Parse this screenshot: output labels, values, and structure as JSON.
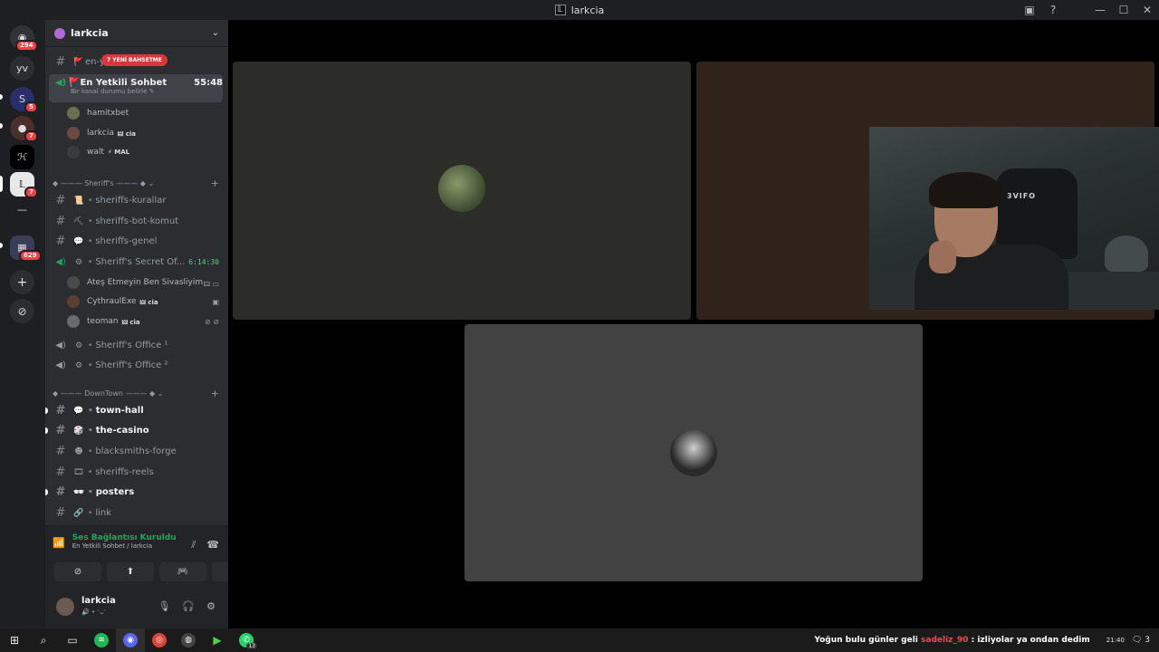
{
  "window": {
    "title": "larkcia"
  },
  "guilds": [
    {
      "name": "discord-home",
      "glyph": "◉",
      "badge": "294"
    },
    {
      "name": "yv",
      "glyph": "yv",
      "badge": ""
    },
    {
      "name": "server-s",
      "glyph": "S",
      "badge": "5"
    },
    {
      "name": "server-photo",
      "glyph": "●",
      "badge": "7"
    },
    {
      "name": "server-h",
      "glyph": "ℋ",
      "badge": ""
    },
    {
      "name": "server-l",
      "glyph": "𝕃",
      "badge": "7"
    },
    {
      "name": "server-line",
      "glyph": "—",
      "badge": ""
    },
    {
      "name": "server-folder",
      "glyph": "▦",
      "badge": "629"
    }
  ],
  "server": {
    "name": "larkcia"
  },
  "mention_bar": "7 YENİ BAHSETME",
  "channels": {
    "partial": {
      "name": "en-y",
      "emoji": "🚩"
    },
    "active": {
      "name": "En Yetkili Sohbet",
      "time": "55:48",
      "sub": "Bir kanal durumu belirle ✎",
      "emoji": "🚩"
    },
    "active_members": [
      {
        "name": "hamitxbet",
        "tag": ""
      },
      {
        "name": "larkcia",
        "tag": "🜲 cia"
      },
      {
        "name": "walt",
        "tag": "⚡ MAL"
      }
    ],
    "category_sheriffs": "◆ ——— Sheriff's ——— ◆ ⌄",
    "sheriffs": [
      {
        "name": "sheriffs-kurallar",
        "emoji": "📜"
      },
      {
        "name": "sheriffs-bot-komut",
        "emoji": "⛏"
      },
      {
        "name": "sheriffs-genel",
        "emoji": "💬"
      }
    ],
    "secret": {
      "name": "Sheriff's Secret Of...",
      "time": "6:14:30"
    },
    "secret_members": [
      {
        "name": "Ateş Etmeyin Ben Sivasliyim",
        "tag": "",
        "icons": "🜲 ▭"
      },
      {
        "name": "CythraulExe",
        "tag": "🜲 cia",
        "icons": "▣"
      },
      {
        "name": "teoman",
        "tag": "🜲 cia",
        "icons": "⊘ ⊘"
      }
    ],
    "office1": "Sheriff's Office ¹",
    "office2": "Sheriff's Office ²",
    "category_downtown": "◆ ——— DownTown ——— ◆ ⌄",
    "downtown": [
      {
        "name": "town-hall",
        "emoji": "💬",
        "bold": true
      },
      {
        "name": "the-casino",
        "emoji": "🎲",
        "bold": true
      },
      {
        "name": "blacksmiths-forge",
        "emoji": "☻",
        "bold": false
      },
      {
        "name": "sheriffs-reels",
        "emoji": "🎞",
        "bold": false
      },
      {
        "name": "posters",
        "emoji": "🕶",
        "bold": true
      },
      {
        "name": "link",
        "emoji": "🔗",
        "bold": false
      }
    ]
  },
  "voice": {
    "status": "Ses Bağlantısı Kuruldu",
    "location": "En Yetkili Sohbet / larkcia"
  },
  "user": {
    "name": "larkcia",
    "status": "🔊 • ᵔᴗᵔ"
  },
  "stage": {
    "tile1_color": "#2c2c28",
    "tile2_color": "#2f231c",
    "tile3_color": "#424242",
    "cam_chair_logo": "3VIFO"
  },
  "taskbar": {
    "ticker_user": "sadeliz_90",
    "ticker_text": ": izliyolar ya ondan dedim",
    "ticker_prefix": "Yoğun bulu günler geli",
    "time": "21:40",
    "notif": "3"
  }
}
